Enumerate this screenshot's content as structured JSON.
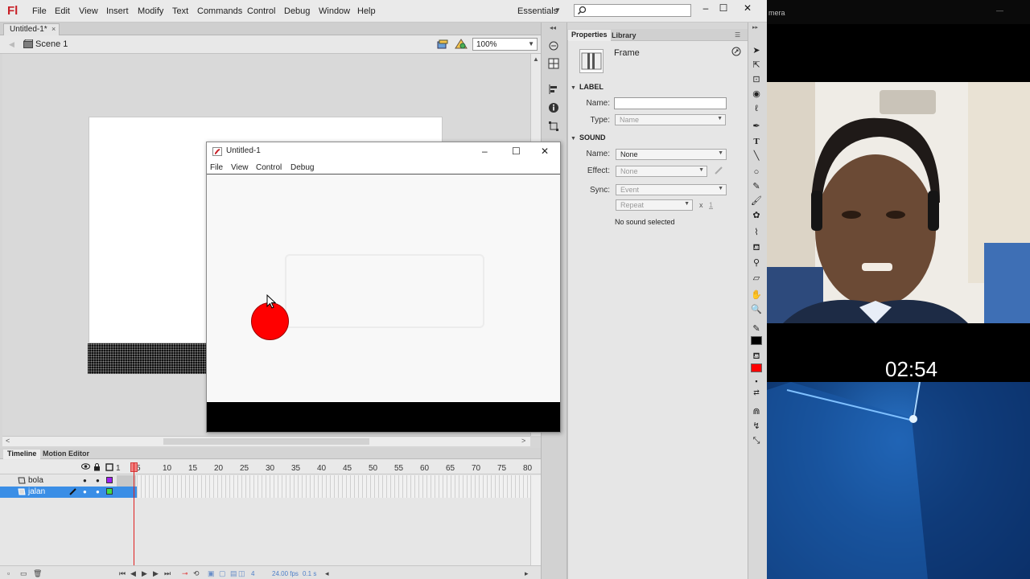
{
  "app": {
    "logo": "Fl",
    "menu": [
      "File",
      "Edit",
      "View",
      "Insert",
      "Modify",
      "Text",
      "Commands",
      "Control",
      "Debug",
      "Window",
      "Help"
    ],
    "workspace": "Essentials",
    "search_placeholder": ""
  },
  "document": {
    "tab": "Untitled-1*",
    "scene": "Scene 1",
    "zoom": "100%"
  },
  "timeline": {
    "tabs": [
      "Timeline",
      "Motion Editor"
    ],
    "header_first_frame": "1",
    "frame_numbers": [
      "5",
      "10",
      "15",
      "20",
      "25",
      "30",
      "35",
      "40",
      "45",
      "50",
      "55",
      "60",
      "65",
      "70",
      "75",
      "80"
    ],
    "layers": [
      {
        "name": "bola",
        "color": "#a020f0",
        "selected": false
      },
      {
        "name": "jalan",
        "color": "#44dd44",
        "selected": true
      }
    ],
    "current_frame": "4",
    "fps": "24.00 fps",
    "elapsed": "0.1 s"
  },
  "properties": {
    "tabs": [
      "Properties",
      "Library"
    ],
    "type_label": "Frame",
    "label_section": "LABEL",
    "name_label": "Name:",
    "name_value": "",
    "type_field_label": "Type:",
    "type_value": "Name",
    "sound_section": "SOUND",
    "sound_name_label": "Name:",
    "sound_name_value": "None",
    "effect_label": "Effect:",
    "effect_value": "None",
    "sync_label": "Sync:",
    "sync_value": "Event",
    "repeat_value": "Repeat",
    "repeat_x": "x",
    "repeat_count": "1",
    "status": "No sound selected"
  },
  "player": {
    "title": "Untitled-1",
    "menu": [
      "File",
      "View",
      "Control",
      "Debug"
    ]
  },
  "camera": {
    "title": "mera",
    "timer": "02:54"
  },
  "colors": {
    "stroke": "#000000",
    "fill": "#ff0000",
    "ball": "#ff0000",
    "selection": "#3a8ee6"
  }
}
